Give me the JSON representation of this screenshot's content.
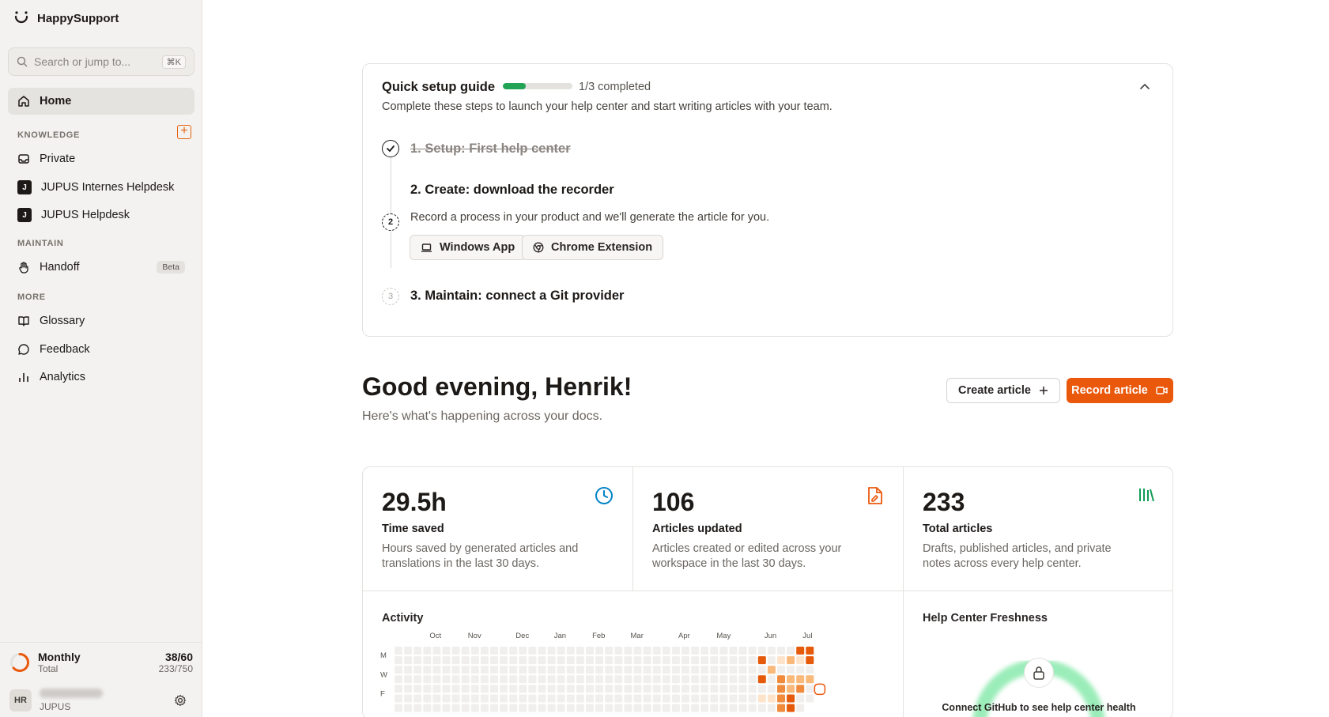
{
  "app": {
    "name": "HappySupport"
  },
  "sidebar": {
    "search": {
      "placeholder": "Search or jump to...",
      "shortcut": "⌘K"
    },
    "home": "Home",
    "knowledge_label": "KNOWLEDGE",
    "knowledge": [
      {
        "label": "Private",
        "icon": "inbox-icon"
      },
      {
        "label": "JUPUS Internes Helpdesk",
        "badge": "J"
      },
      {
        "label": "JUPUS Helpdesk",
        "badge": "J"
      }
    ],
    "maintain_label": "MAINTAIN",
    "handoff": {
      "label": "Handoff",
      "badge": "Beta"
    },
    "more_label": "MORE",
    "more": [
      {
        "label": "Glossary",
        "icon": "book-icon"
      },
      {
        "label": "Feedback",
        "icon": "message-icon"
      },
      {
        "label": "Analytics",
        "icon": "bar-chart-icon"
      }
    ],
    "usage": {
      "title": "Monthly",
      "subtitle": "Total",
      "value": "38/60",
      "total": "233/750",
      "fraction": 0.63
    },
    "user": {
      "initials": "HR",
      "org": "JUPUS"
    }
  },
  "guide": {
    "title": "Quick setup guide",
    "progress_fraction": 0.333,
    "progress_text": "1/3 completed",
    "description": "Complete these steps to launch your help center and start writing articles with your team.",
    "steps": [
      {
        "num": "1",
        "title": "1. Setup: First help center",
        "done": true
      },
      {
        "num": "2",
        "title": "2. Create: download the recorder",
        "desc": "Record a process in your product and we'll generate the article for you.",
        "buttons": [
          "Windows App",
          "Chrome Extension"
        ]
      },
      {
        "num": "3",
        "title": "3. Maintain: connect a Git provider"
      }
    ]
  },
  "greeting": {
    "title": "Good evening, Henrik!",
    "subtitle": "Here's what's happening across your docs."
  },
  "actions": {
    "create": "Create article",
    "record": "Record article"
  },
  "stats": [
    {
      "value": "29.5h",
      "label": "Time saved",
      "desc": "Hours saved by generated articles and translations in the last 30 days.",
      "icon": "clock-icon",
      "color": "#0284c7"
    },
    {
      "value": "106",
      "label": "Articles updated",
      "desc": "Articles created or edited across your workspace in the last 30 days.",
      "icon": "file-edit-icon",
      "color": "#ea580c"
    },
    {
      "value": "233",
      "label": "Total articles",
      "desc": "Drafts, published articles, and private notes across every help center.",
      "icon": "library-icon",
      "color": "#0f9d58"
    }
  ],
  "activity": {
    "title": "Activity",
    "months": [
      "Oct",
      "Nov",
      "Dec",
      "Jan",
      "Feb",
      "Mar",
      "Apr",
      "May",
      "Jun",
      "Jul"
    ],
    "days": [
      "M",
      "W",
      "F"
    ],
    "colors": {
      "empty": "#f0efed",
      "l1": "#fde3c9",
      "l2": "#f9b97a",
      "l3": "#f08a3c",
      "l4": "#e65a0c"
    }
  },
  "freshness": {
    "title": "Help Center Freshness",
    "message": "Connect GitHub to see help center health"
  }
}
